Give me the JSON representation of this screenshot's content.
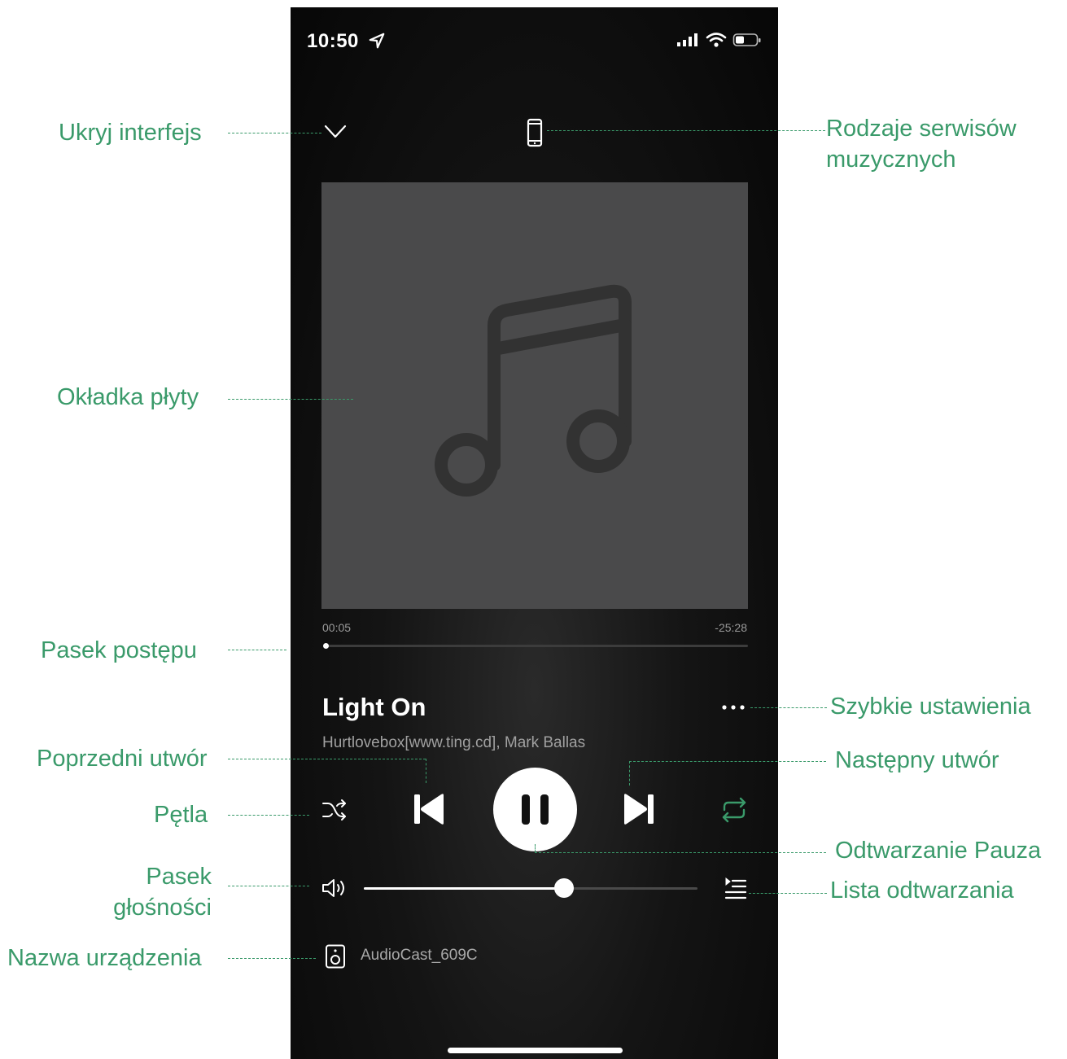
{
  "status_bar": {
    "time": "10:50"
  },
  "player": {
    "progress": {
      "elapsed": "00:05",
      "remaining": "-25:28",
      "fraction": 0.003
    },
    "track": {
      "title": "Light On",
      "artist": "Hurtlovebox[www.ting.cd], Mark Ballas"
    },
    "volume": {
      "fraction": 0.6
    },
    "device_name": "AudioCast_609C"
  },
  "annotations": {
    "hide_ui": "Ukryj interfejs",
    "music_services_line1": "Rodzaje serwisów",
    "music_services_line2": "muzycznych",
    "album_cover": "Okładka płyty",
    "progress_bar": "Pasek postępu",
    "quick_settings": "Szybkie ustawienia",
    "previous_track": "Poprzedni utwór",
    "next_track": "Następny utwór",
    "loop": "Pętla",
    "play_pause": "Odtwarzanie Pauza",
    "volume_bar_line1": "Pasek",
    "volume_bar_line2": "głośności",
    "playlist": "Lista odtwarzania",
    "device_name": "Nazwa urządzenia"
  },
  "colors": {
    "annotation": "#3a9a6a",
    "repeat_active": "#3a9a6a",
    "cover": "#4a4a4b"
  },
  "icons": [
    "location-arrow-icon",
    "signal-icon",
    "wifi-icon",
    "battery-icon",
    "chevron-down-icon",
    "phone-icon",
    "music-note-icon",
    "more-icon",
    "shuffle-icon",
    "previous-icon",
    "pause-icon",
    "next-icon",
    "repeat-icon",
    "volume-icon",
    "playlist-icon",
    "speaker-icon"
  ]
}
